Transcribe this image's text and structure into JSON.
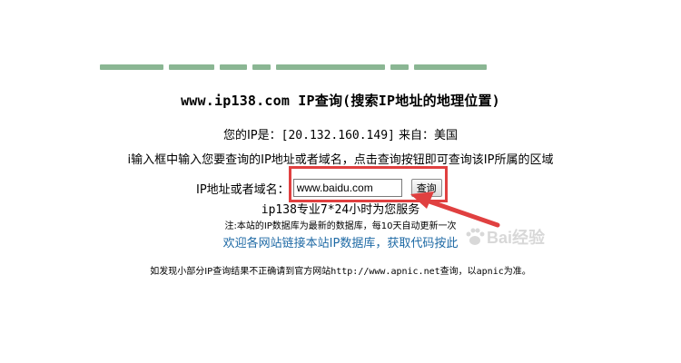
{
  "page": {
    "title": "www.ip138.com IP查询(搜索IP地址的地理位置)",
    "ip_label": "您的IP是：",
    "ip_value": "[20.132.160.149]",
    "from_label": "来自：",
    "from_value": "美国",
    "instructions": "i输入框中输入您要查询的IP地址或者域名，点击查询按钮即可查询该IP所属的区域",
    "form": {
      "label": "IP地址或者域名：",
      "input_value": "www.baidu.com",
      "button_label": "查询"
    },
    "service_line": "ip138专业7*24小时为您服务",
    "note": "注:本站的IP数据库为最新的数据库，每10天自动更新一次",
    "link_text": "欢迎各网站链接本站IP数据库，获取代码按此",
    "footer": {
      "prefix": "如发现小部分IP查询结果不正确请到官方网站",
      "url": "http://www.apnic.net",
      "middle": "查询，以",
      "brand": "apnic",
      "suffix": "为准。"
    }
  },
  "annotation": {
    "highlight_color": "#e04040",
    "link_color": "#1f6aa5"
  },
  "watermark": {
    "text": "Bai经验"
  }
}
